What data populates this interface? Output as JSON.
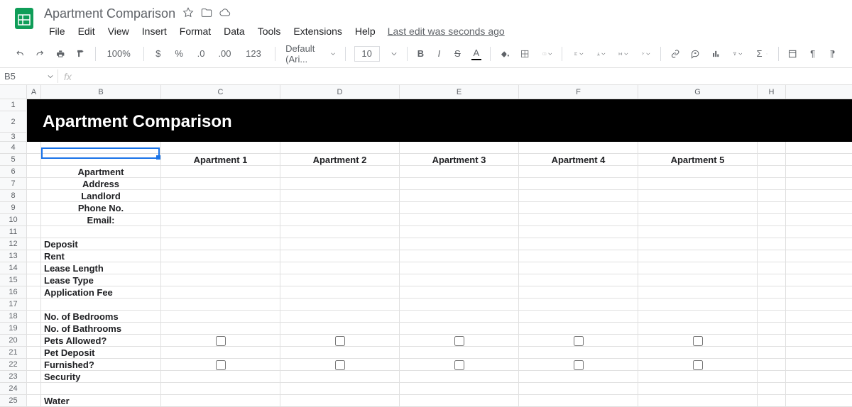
{
  "doc_title": "Apartment Comparison",
  "menus": {
    "file": "File",
    "edit": "Edit",
    "view": "View",
    "insert": "Insert",
    "format": "Format",
    "data": "Data",
    "tools": "Tools",
    "extensions": "Extensions",
    "help": "Help"
  },
  "last_edit": "Last edit was seconds ago",
  "toolbar": {
    "zoom": "100%",
    "currency": "$",
    "percent": "%",
    "dec_dec": ".0",
    "inc_dec": ".00",
    "num_fmt": "123",
    "font": "Default (Ari...",
    "size": "10",
    "bold": "B",
    "italic": "I",
    "strike": "S",
    "textcolor": "A"
  },
  "namebox": "B5",
  "fx_label": "fx",
  "columns": {
    "A": "A",
    "B": "B",
    "C": "C",
    "D": "D",
    "E": "E",
    "F": "F",
    "G": "G",
    "H": "H"
  },
  "row_count": 25,
  "banner_title": "Apartment Comparison",
  "headers": {
    "c": "Apartment 1",
    "d": "Apartment 2",
    "e": "Apartment 3",
    "f": "Apartment 4",
    "g": "Apartment 5"
  },
  "labels": {
    "apartment": "Apartment",
    "address": "Address",
    "landlord": "Landlord",
    "phone": "Phone No.",
    "email": "Email:",
    "deposit": "Deposit",
    "rent": "Rent",
    "lease_length": "Lease Length",
    "lease_type": "Lease Type",
    "app_fee": "Application Fee",
    "bedrooms": "No. of Bedrooms",
    "bathrooms": "No. of Bathrooms",
    "pets": "Pets Allowed?",
    "pet_deposit": "Pet Deposit",
    "furnished": "Furnished?",
    "security": "Security",
    "water": "Water"
  }
}
